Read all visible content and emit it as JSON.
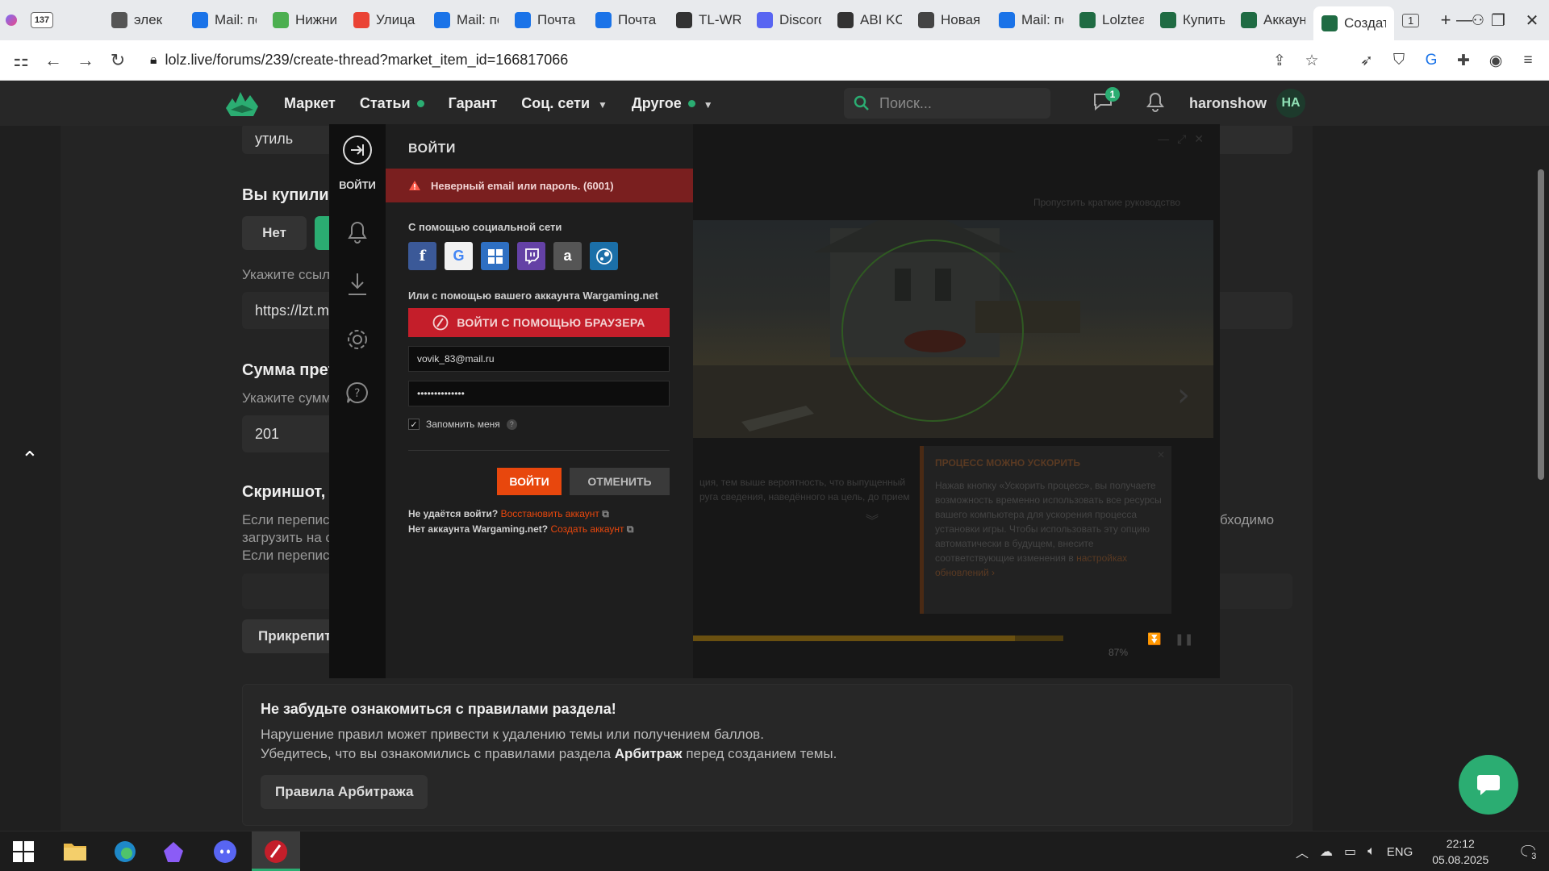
{
  "browser": {
    "tabs": [
      {
        "label": "",
        "badge": "137",
        "icon_color": "#7b6cf6"
      },
      {
        "label": "элек",
        "icon_color": "#555555"
      },
      {
        "label": "Mail: по",
        "icon_color": "#1a73e8"
      },
      {
        "label": "Нижние",
        "icon_color": "#4caf50"
      },
      {
        "label": "Улица Б",
        "icon_color": "#ea4335"
      },
      {
        "label": "Mail: по",
        "icon_color": "#1a73e8"
      },
      {
        "label": "Почта М",
        "icon_color": "#1a73e8"
      },
      {
        "label": "Почта М",
        "icon_color": "#1a73e8"
      },
      {
        "label": "TL-WR",
        "icon_color": "#333333"
      },
      {
        "label": "Discord",
        "icon_color": "#5865f2"
      },
      {
        "label": "ABI KCD",
        "icon_color": "#333333"
      },
      {
        "label": "Новая в",
        "icon_color": "#444444"
      },
      {
        "label": "Mail: по",
        "icon_color": "#1a73e8"
      },
      {
        "label": "Lolzteа",
        "icon_color": "#1f6b43"
      },
      {
        "label": "Купить",
        "icon_color": "#1f6b43"
      },
      {
        "label": "Аккаун",
        "icon_color": "#1f6b43"
      },
      {
        "label": "Создат",
        "icon_color": "#1f6b43",
        "active": true
      }
    ],
    "tab_count_badge": "1",
    "url": "lolz.live/forums/239/create-thread?market_item_id=166817066"
  },
  "site": {
    "nav": [
      {
        "label": "Маркет",
        "dot": false,
        "chevron": false
      },
      {
        "label": "Статьи",
        "dot": true,
        "chevron": false
      },
      {
        "label": "Гарант",
        "dot": false,
        "chevron": false
      },
      {
        "label": "Соц. сети",
        "dot": false,
        "chevron": true
      },
      {
        "label": "Другое",
        "dot": true,
        "chevron": true
      }
    ],
    "search_placeholder": "Поиск...",
    "messages_badge": "1",
    "username": "haronshow",
    "avatar_initials": "НА"
  },
  "form": {
    "field_util": "утиль",
    "bought_heading": "Вы купили",
    "btn_no": "Нет",
    "link_hint": "Укажите ссыл",
    "link_value": "https://lzt.m",
    "sum_heading": "Сумма прет",
    "sum_hint": "Укажите сумм",
    "sum_value": "201",
    "screenshot_heading": "Скриншот,",
    "screenshot_text_1": "Если перепис",
    "screenshot_text_2": "загрузить на с",
    "screenshot_text_3": "Если перепис",
    "screenshot_text_right": "бходимо",
    "attach_button": "Прикрепит"
  },
  "rules": {
    "heading": "Не забудьте ознакомиться с правилами раздела!",
    "line1": "Нарушение правил может привести к удалению темы или получением баллов.",
    "line2_before": "Убедитесь, что вы ознакомились с правилами раздела ",
    "line2_bold": "Арбитраж",
    "line2_after": " перед созданием темы.",
    "button": "Правила Арбитража"
  },
  "wargaming": {
    "side_login_label": "ВОЙТИ",
    "title": "ВОЙТИ",
    "error": "Неверный email или пароль. (6001)",
    "social_label": "С помощью социальной сети",
    "account_label": "Или с помощью вашего аккаунта Wargaming.net",
    "browser_login": "ВОЙТИ С ПОМОЩЬЮ БРАУЗЕРА",
    "email_value": "vovik_83@mail.ru",
    "password_value": "••••••••••••••",
    "remember_label": "Запомнить меня",
    "login_button": "ВОЙТИ",
    "cancel_button": "ОТМЕНИТЬ",
    "cant_login": "Не удаётся войти?",
    "restore_link": "Восстановить аккаунт",
    "no_account": "Нет аккаунта Wargaming.net?",
    "create_link": "Создать аккаунт",
    "skip_guide": "Пропустить краткие руководство",
    "tip_title": "ПРОЦЕСС МОЖНО УСКОРИТЬ",
    "tip_body": "Нажав кнопку «Ускорить процесс», вы получаете возможность временно использовать все ресурсы вашего компьютера для ускорения процесса установки игры. Чтобы использовать эту опцию автоматически в будущем, внесите соответствующие изменения в",
    "tip_link": "настройках обновлений ›",
    "dim_text_1": "ция, тем выше вероятность, что выпущенный",
    "dim_text_2": "руга сведения, наведённого на цель, до прием",
    "progress_percent": 87,
    "progress_label": "87%"
  },
  "taskbar": {
    "lang": "ENG",
    "time": "22:12",
    "date": "05.08.2025",
    "notif_count": "3"
  }
}
